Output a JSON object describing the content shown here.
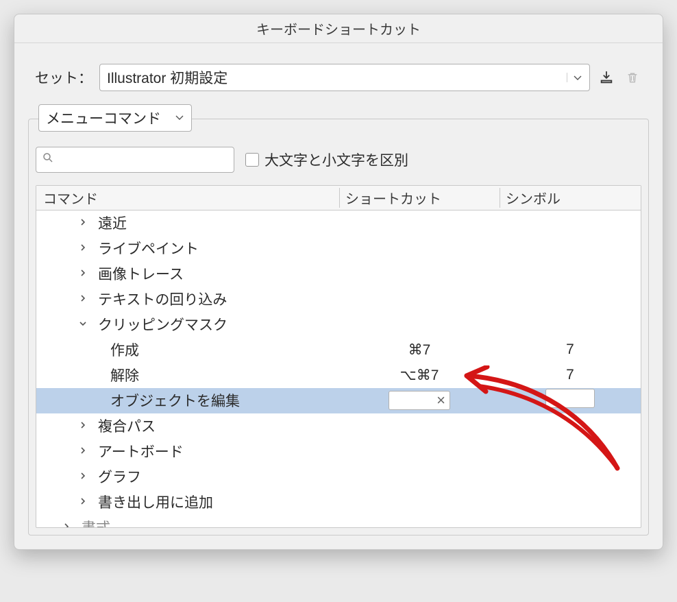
{
  "title": "キーボードショートカット",
  "set": {
    "label": "セット：",
    "value": "Illustrator 初期設定"
  },
  "scope": {
    "value": "メニューコマンド"
  },
  "search": {
    "placeholder": ""
  },
  "case_sensitive": {
    "label": "大文字と小文字を区別"
  },
  "columns": {
    "command": "コマンド",
    "shortcut": "ショートカット",
    "symbol": "シンボル"
  },
  "rows": [
    {
      "type": "group",
      "level": 1,
      "label": "遠近"
    },
    {
      "type": "group",
      "level": 1,
      "label": "ライブペイント"
    },
    {
      "type": "group",
      "level": 1,
      "label": "画像トレース"
    },
    {
      "type": "group",
      "level": 1,
      "label": "テキストの回り込み"
    },
    {
      "type": "group",
      "level": 1,
      "label": "クリッピングマスク",
      "expanded": true
    },
    {
      "type": "item",
      "level": 2,
      "label": "作成",
      "shortcut": "⌘7",
      "symbol": "7"
    },
    {
      "type": "item",
      "level": 2,
      "label": "解除",
      "shortcut": "⌥⌘7",
      "symbol": "7"
    },
    {
      "type": "item",
      "level": 2,
      "label": "オブジェクトを編集",
      "editing": true
    },
    {
      "type": "group",
      "level": 1,
      "label": "複合パス"
    },
    {
      "type": "group",
      "level": 1,
      "label": "アートボード"
    },
    {
      "type": "group",
      "level": 1,
      "label": "グラフ"
    },
    {
      "type": "group",
      "level": 1,
      "label": "書き出し用に追加"
    },
    {
      "type": "group",
      "level": 0,
      "label": "書式",
      "dim": true
    }
  ]
}
